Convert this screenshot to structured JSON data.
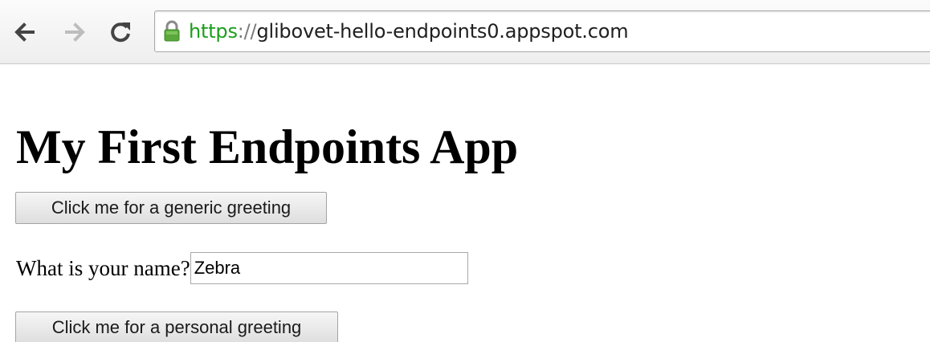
{
  "browser": {
    "back_icon": "back-arrow-icon",
    "forward_icon": "forward-arrow-icon",
    "reload_icon": "reload-icon",
    "lock_icon": "lock-icon",
    "lock_color": "#5aa83c",
    "url": {
      "scheme": "https",
      "separator": "://",
      "host": "glibovet-hello-endpoints0.appspot.com"
    }
  },
  "page": {
    "title": "My First Endpoints App",
    "generic_button_label": "Click me for a generic greeting",
    "name_label": "What is your name?",
    "name_value": "Zebra",
    "personal_button_label": "Click me for a personal greeting"
  }
}
